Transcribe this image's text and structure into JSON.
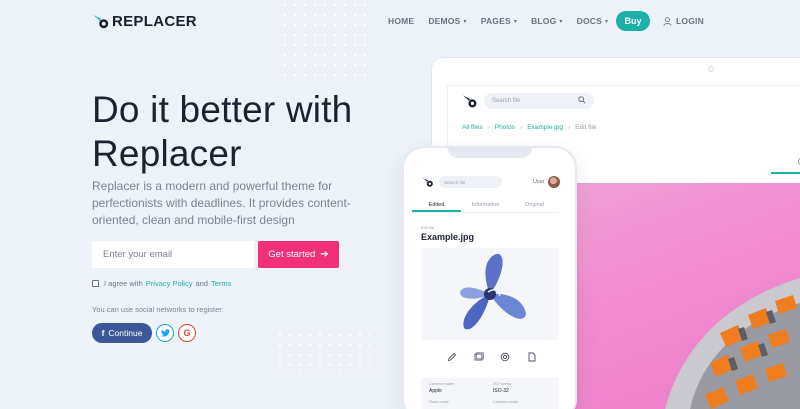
{
  "brand": {
    "name": "REPLACER",
    "accent": "#1bb0a8",
    "pink": "#f1307c"
  },
  "nav": {
    "items": [
      {
        "label": "HOME",
        "dropdown": false
      },
      {
        "label": "DEMOS",
        "dropdown": true
      },
      {
        "label": "PAGES",
        "dropdown": true
      },
      {
        "label": "BLOG",
        "dropdown": true
      },
      {
        "label": "DOCS",
        "dropdown": true
      }
    ],
    "buy": "Buy",
    "login": "LOGIN"
  },
  "hero": {
    "title": "Do it better with Replacer",
    "subtitle": "Replacer is a modern and powerful theme for perfectionists with deadlines. It provides content-oriented, clean and mobile-first design",
    "email_placeholder": "Enter your email",
    "cta": "Get started",
    "agree_prefix": "I agree with",
    "privacy_link": "Privacy Policy",
    "and": "and",
    "terms_link": "Terms",
    "social_label": "You can use social networks to register:",
    "facebook": "Continue",
    "twitter_icon": "twitter-icon",
    "google_label": "G"
  },
  "desktop_mock": {
    "search_placeholder": "Search file",
    "breadcrumb": [
      "All files",
      "Photos",
      "Example.jpg",
      "Edit file"
    ]
  },
  "phone_mock": {
    "search_placeholder": "Search file",
    "user": "User",
    "tabs": [
      "Edited",
      "Information",
      "Original"
    ],
    "active_tab": 0,
    "edit_label": "Edit file",
    "file_title": "Example.jpg",
    "meta": [
      {
        "label": "Camera maker",
        "value": "Apple"
      },
      {
        "label": "ISO speed",
        "value": "ISO-32"
      },
      {
        "label": "Flash mode",
        "value": ""
      },
      {
        "label": "Camera model",
        "value": ""
      }
    ]
  }
}
